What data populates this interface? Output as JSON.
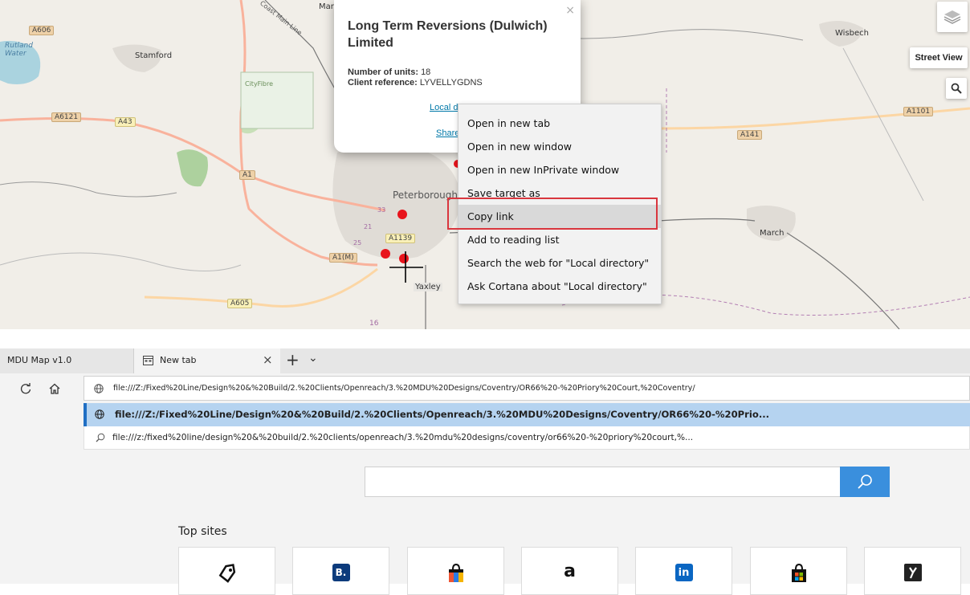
{
  "map": {
    "place_labels": [
      "A606",
      "Rutland Water",
      "Stamford",
      "A6121",
      "A43",
      "A1",
      "Peterborough",
      "A1139",
      "A1(M)",
      "Yaxley",
      "A605",
      "16",
      "Wisbech",
      "A1101",
      "A141",
      "March",
      "Coast Main Line",
      "Mar",
      "CityFibre",
      "25",
      "33",
      "21"
    ],
    "marker_color": "#e8141c",
    "popup": {
      "close_symbol": "×",
      "title": "Long Term Reversions (Dulwich) Limited",
      "units_label": "Number of units:",
      "units_value": "18",
      "client_ref_label": "Client reference:",
      "client_ref_value": "LYVELLYGDNS",
      "link_local": "Local d",
      "link_share": "Share"
    },
    "controls": {
      "layers_icon": "layers-icon",
      "street_view_label": "Street View",
      "search_icon": "search-icon"
    }
  },
  "context_menu": {
    "items": [
      "Open in new tab",
      "Open in new window",
      "Open in new InPrivate window",
      "Save target as",
      "Copy link",
      "Add to reading list",
      "Search the web for \"Local directory\"",
      "Ask Cortana about \"Local directory\""
    ],
    "selected_index": 4,
    "highlight_color": "#d9363e"
  },
  "browser": {
    "tabs": [
      {
        "label": "MDU Map v1.0",
        "active": false
      },
      {
        "label": "New tab",
        "active": true
      }
    ],
    "tab_close_symbol": "×",
    "new_tab_symbol": "+",
    "tab_list_symbol": "⌄",
    "address_value": "file:///Z:/Fixed%20Line/Design%20&%20Build/2.%20Clients/Openreach/3.%20MDU%20Designs/Coventry/OR66%20-%20Priory%20Court,%20Coventry/",
    "suggestions": [
      {
        "text": "file:///Z:/Fixed%20Line/Design%20&%20Build/2.%20Clients/Openreach/3.%20MDU%20Designs/Coventry/OR66%20-%20Prio...",
        "icon": "globe-icon",
        "selected": true
      },
      {
        "text": "file:///z:/fixed%20line/design%20&%20build/2.%20clients/openreach/3.%20mdu%20designs/coventry/or66%20-%20priory%20court,%...",
        "icon": "search-icon",
        "selected": false
      }
    ],
    "search_placeholder": "",
    "top_sites_label": "Top sites",
    "top_sites": [
      {
        "icon": "tag-icon"
      },
      {
        "icon": "booking-icon",
        "text": "B."
      },
      {
        "icon": "shopping-bag-icon"
      },
      {
        "icon": "amazon-icon",
        "text": "a"
      },
      {
        "icon": "linkedin-icon",
        "text": "in"
      },
      {
        "icon": "microsoft-store-icon"
      },
      {
        "icon": "app-icon"
      }
    ],
    "accent_color": "#3a8fdd"
  }
}
